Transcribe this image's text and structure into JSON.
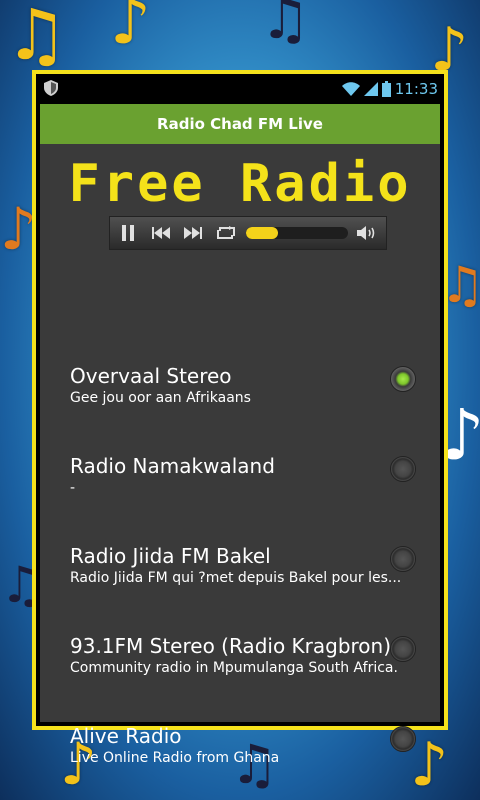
{
  "status_bar": {
    "time": "11:33"
  },
  "app": {
    "title": "Radio Chad FM Live"
  },
  "banner": {
    "text": "Free Radio"
  },
  "player": {
    "progress_percent": 32
  },
  "stations": [
    {
      "title": "Overvaal Stereo",
      "subtitle": "Gee jou oor aan Afrikaans",
      "selected": true
    },
    {
      "title": "Radio Namakwaland",
      "subtitle": "-",
      "selected": false
    },
    {
      "title": "Radio Jiida FM Bakel",
      "subtitle": "Radio Jiida FM qui ?met depuis Bakel pour les...",
      "selected": false
    },
    {
      "title": "93.1FM Stereo (Radio Kragbron)",
      "subtitle": "Community radio in Mpumulanga  South Africa.",
      "selected": false
    },
    {
      "title": "Alive Radio",
      "subtitle": "Live Online Radio from Ghana",
      "selected": false
    }
  ],
  "colors": {
    "accent_bar": "#6aa130",
    "banner_yellow": "#f4e21a",
    "frame_yellow": "#f5e21c",
    "radio_selected": "#7dc62a"
  }
}
